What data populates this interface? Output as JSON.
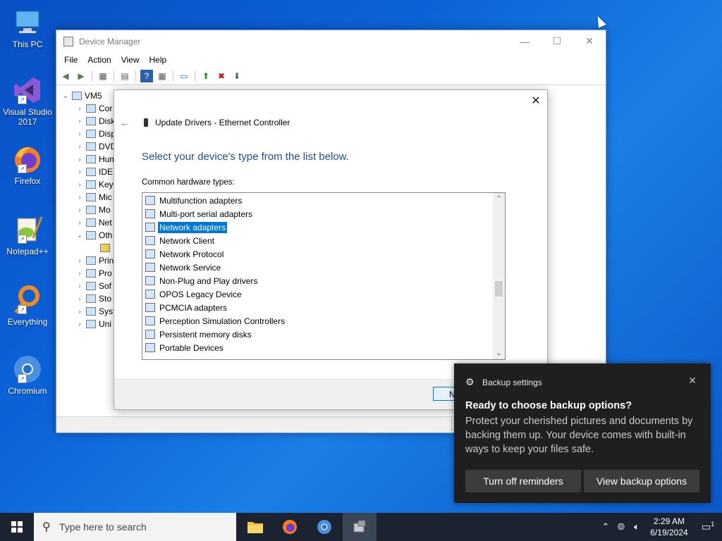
{
  "desktop": {
    "icons": [
      {
        "label": "This PC",
        "icon": "this-pc-icon"
      },
      {
        "label": "Visual Studio 2017",
        "icon": "visual-studio-icon"
      },
      {
        "label": "Firefox",
        "icon": "firefox-icon"
      },
      {
        "label": "Notepad++",
        "icon": "notepadpp-icon"
      },
      {
        "label": "Everything",
        "icon": "everything-icon"
      },
      {
        "label": "Chromium",
        "icon": "chromium-icon"
      }
    ]
  },
  "device_manager": {
    "title": "Device Manager",
    "menu": [
      "File",
      "Action",
      "View",
      "Help"
    ],
    "tree": {
      "root": "VM5",
      "items": [
        "Cor",
        "Disk",
        "Disp",
        "DVD",
        "Hum",
        "IDE",
        "Key",
        "Mic",
        "Mo",
        "Net",
        "Oth",
        "Prin",
        "Pro",
        "Sof",
        "Sto",
        "Syst",
        "Uni"
      ]
    }
  },
  "update_drivers": {
    "header": "Update Drivers - Ethernet Controller",
    "question": "Select your device's type from the list below.",
    "list_label": "Common hardware types:",
    "items": [
      "Multifunction adapters",
      "Multi-port serial adapters",
      "Network adapters",
      "Network Client",
      "Network Protocol",
      "Network Service",
      "Non-Plug and Play drivers",
      "OPOS Legacy Device",
      "PCMCIA adapters",
      "Perception Simulation Controllers",
      "Persistent memory disks",
      "Portable Devices"
    ],
    "selected_index": 2,
    "next_button": "N"
  },
  "toast": {
    "app": "Backup settings",
    "title": "Ready to choose backup options?",
    "body": "Protect your cherished pictures and documents by backing them up. Your device comes with built-in ways to keep your files safe.",
    "button_1": "Turn off reminders",
    "button_2": "View backup options"
  },
  "taskbar": {
    "search_placeholder": "Type here to search",
    "time": "2:29 AM",
    "date": "6/19/2024",
    "notification_count": "1"
  },
  "colors": {
    "accent": "#0078d7",
    "heading": "#1c4f99",
    "toast_bg": "#1f1f1f",
    "taskbar_bg": "#1b2330"
  }
}
